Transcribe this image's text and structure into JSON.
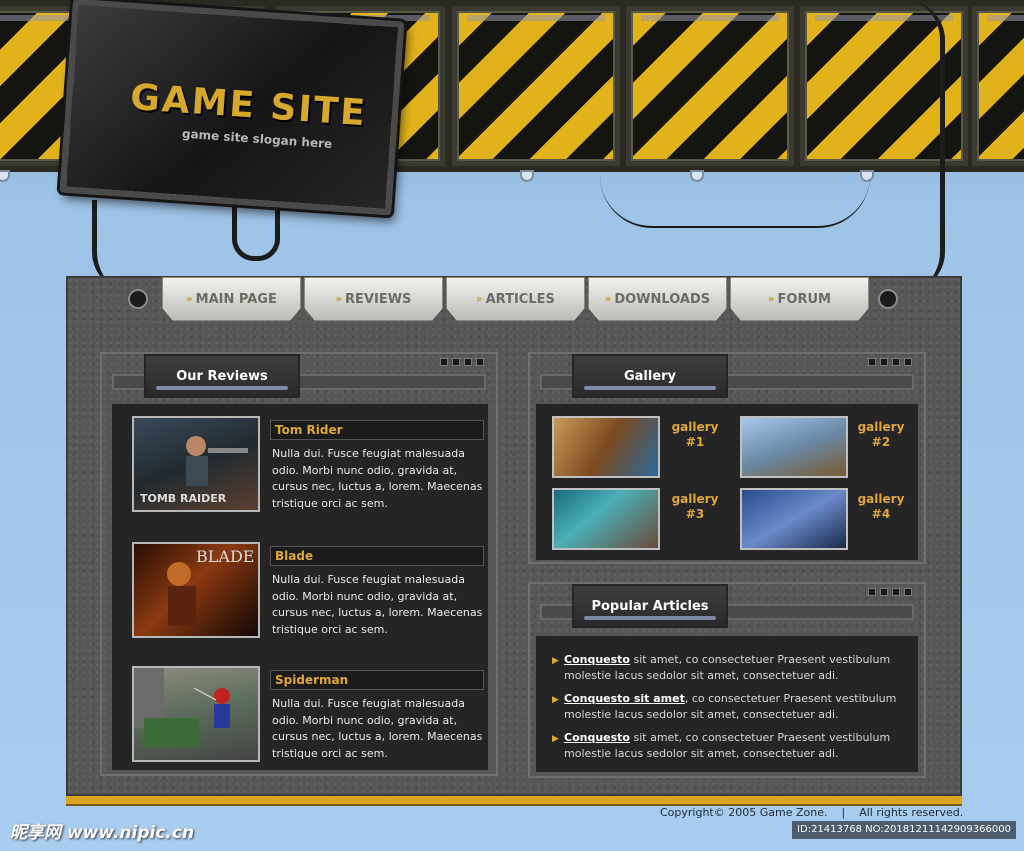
{
  "logo": {
    "title": "GAME SITE",
    "slogan": "game site slogan here"
  },
  "nav": [
    {
      "label": "MAIN PAGE"
    },
    {
      "label": "REVIEWS"
    },
    {
      "label": "ARTICLES"
    },
    {
      "label": "DOWNLOADS"
    },
    {
      "label": "FORUM"
    }
  ],
  "reviews": {
    "heading": "Our Reviews",
    "items": [
      {
        "title": "Tom Rider",
        "text": "Nulla dui. Fusce feugiat malesuada odio. Morbi nunc odio, gravida at, cursus nec, luctus a, lorem. Maecenas tristique orci ac sem.",
        "thumb_caption": "TOMB RAIDER"
      },
      {
        "title": "Blade",
        "text": "Nulla dui. Fusce feugiat malesuada odio. Morbi nunc odio, gravida at, cursus nec, luctus a, lorem. Maecenas tristique orci ac sem.",
        "thumb_caption": "BLADE"
      },
      {
        "title": "Spiderman",
        "text": "Nulla dui. Fusce feugiat malesuada odio. Morbi nunc odio, gravida at, cursus nec, luctus a, lorem. Maecenas tristique orci ac sem.",
        "thumb_caption": ""
      }
    ]
  },
  "gallery": {
    "heading": "Gallery",
    "items": [
      {
        "line1": "gallery",
        "line2": "#1"
      },
      {
        "line1": "gallery",
        "line2": "#2"
      },
      {
        "line1": "gallery",
        "line2": "#3"
      },
      {
        "line1": "gallery",
        "line2": "#4"
      }
    ]
  },
  "articles": {
    "heading": "Popular Articles",
    "items": [
      {
        "link": "Conquesto",
        "text": " sit amet,  co consectetuer Praesent vestibulum molestie lacus sedolor sit amet, consectetuer adi."
      },
      {
        "link": "Conquesto sit amet",
        "text": ",  co consectetuer Praesent vestibulum molestie lacus sedolor sit amet, consectetuer adi."
      },
      {
        "link": "Conquesto",
        "text": " sit amet,  co consectetuer Praesent vestibulum molestie lacus sedolor sit amet, consectetuer adi."
      }
    ]
  },
  "footer": {
    "copyright": "Copyright© 2005 Game Zone.",
    "separator": "|",
    "rights": "All rights reserved."
  },
  "watermark": {
    "site": "昵享网 www.nipic.cn",
    "id": "ID:21413768 NO:20181211142909366000"
  },
  "colors": {
    "accent": "#e0a830",
    "hazard_yellow": "#e2b21b",
    "background": "#a9cdef",
    "board": "#575757"
  },
  "icons": {
    "nav": "double-chevron-right-icon",
    "list": "triangle-bullet-icon"
  }
}
